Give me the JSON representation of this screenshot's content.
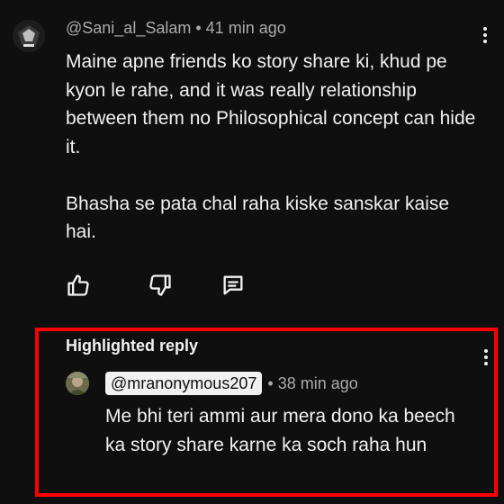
{
  "comment": {
    "author": "@Sani_al_Salam",
    "time": "41 min ago",
    "paragraphs": [
      "Maine apne friends ko story share ki, khud pe kyon le rahe, and it was really relationship between them no Philosophical concept can hide it.",
      "Bhasha se pata chal raha kiske sanskar kaise hai."
    ],
    "icons": [
      "like-icon",
      "dislike-icon",
      "reply-icon",
      "more-vert-icon"
    ]
  },
  "highlighted_reply": {
    "label": "Highlighted reply",
    "author": "@mranonymous207",
    "time": "38 min ago",
    "text": "Me bhi teri ammi aur mera dono ka beech ka story share karne ka soch raha hun",
    "highlight_color": "#ff0000"
  },
  "colors": {
    "background": "#0f0f0f",
    "text": "#f1f1f1",
    "secondary_text": "#aaaaaa"
  }
}
